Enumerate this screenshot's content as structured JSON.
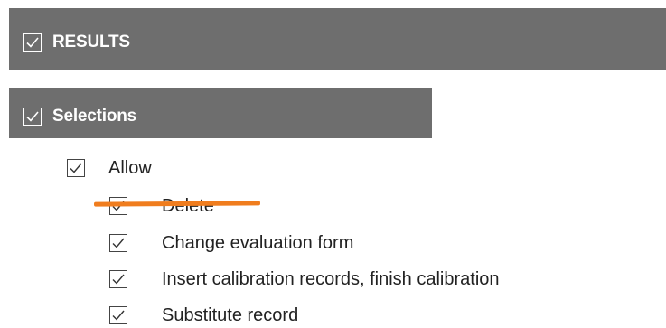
{
  "results": {
    "label": "RESULTS",
    "checked": true
  },
  "selections": {
    "label": "Selections",
    "checked": true
  },
  "allow": {
    "label": "Allow",
    "checked": true,
    "children": [
      {
        "label": "Delete",
        "checked": true,
        "struck_out": true
      },
      {
        "label": "Change evaluation form",
        "checked": true
      },
      {
        "label": "Insert calibration records, finish calibration",
        "checked": true
      },
      {
        "label": "Substitute record",
        "checked": true
      }
    ]
  },
  "colors": {
    "header_bg": "#6e6e6e",
    "header_text": "#ffffff",
    "strike_mark": "#f07d1e"
  },
  "icons": {
    "checkbox": "checkmark-icon"
  }
}
